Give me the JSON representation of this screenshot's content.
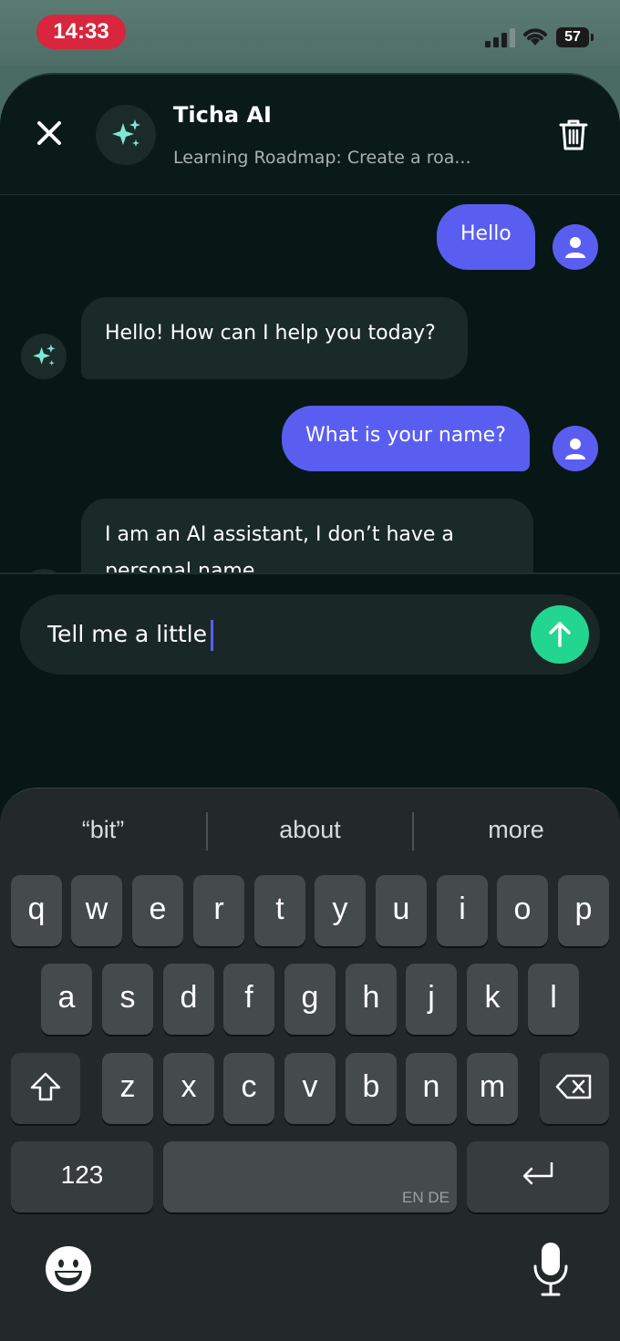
{
  "status_bar": {
    "time": "14:33",
    "battery": "57"
  },
  "header": {
    "title": "Ticha AI",
    "subtitle": "Learning Roadmap: Create a roa..."
  },
  "messages": [
    {
      "role": "user",
      "text": "Hello"
    },
    {
      "role": "ai",
      "text": "Hello! How can I help you today?"
    },
    {
      "role": "user",
      "text": "What is your name?"
    },
    {
      "role": "ai",
      "text": "I am an AI assistant, I don’t have a personal name."
    }
  ],
  "composer": {
    "value": "Tell me a little"
  },
  "keyboard": {
    "suggestions": [
      "“bit”",
      "about",
      "more"
    ],
    "row1": [
      "q",
      "w",
      "e",
      "r",
      "t",
      "y",
      "u",
      "i",
      "o",
      "p"
    ],
    "row2": [
      "a",
      "s",
      "d",
      "f",
      "g",
      "h",
      "j",
      "k",
      "l"
    ],
    "row3": [
      "z",
      "x",
      "c",
      "v",
      "b",
      "n",
      "m"
    ],
    "numbers_key": "123",
    "language": "EN DE"
  },
  "colors": {
    "user_bubble": "#5a5ef0",
    "send_button": "#22d68f",
    "sparkle": "#7ee8d6",
    "time_pill": "#d7263d"
  }
}
